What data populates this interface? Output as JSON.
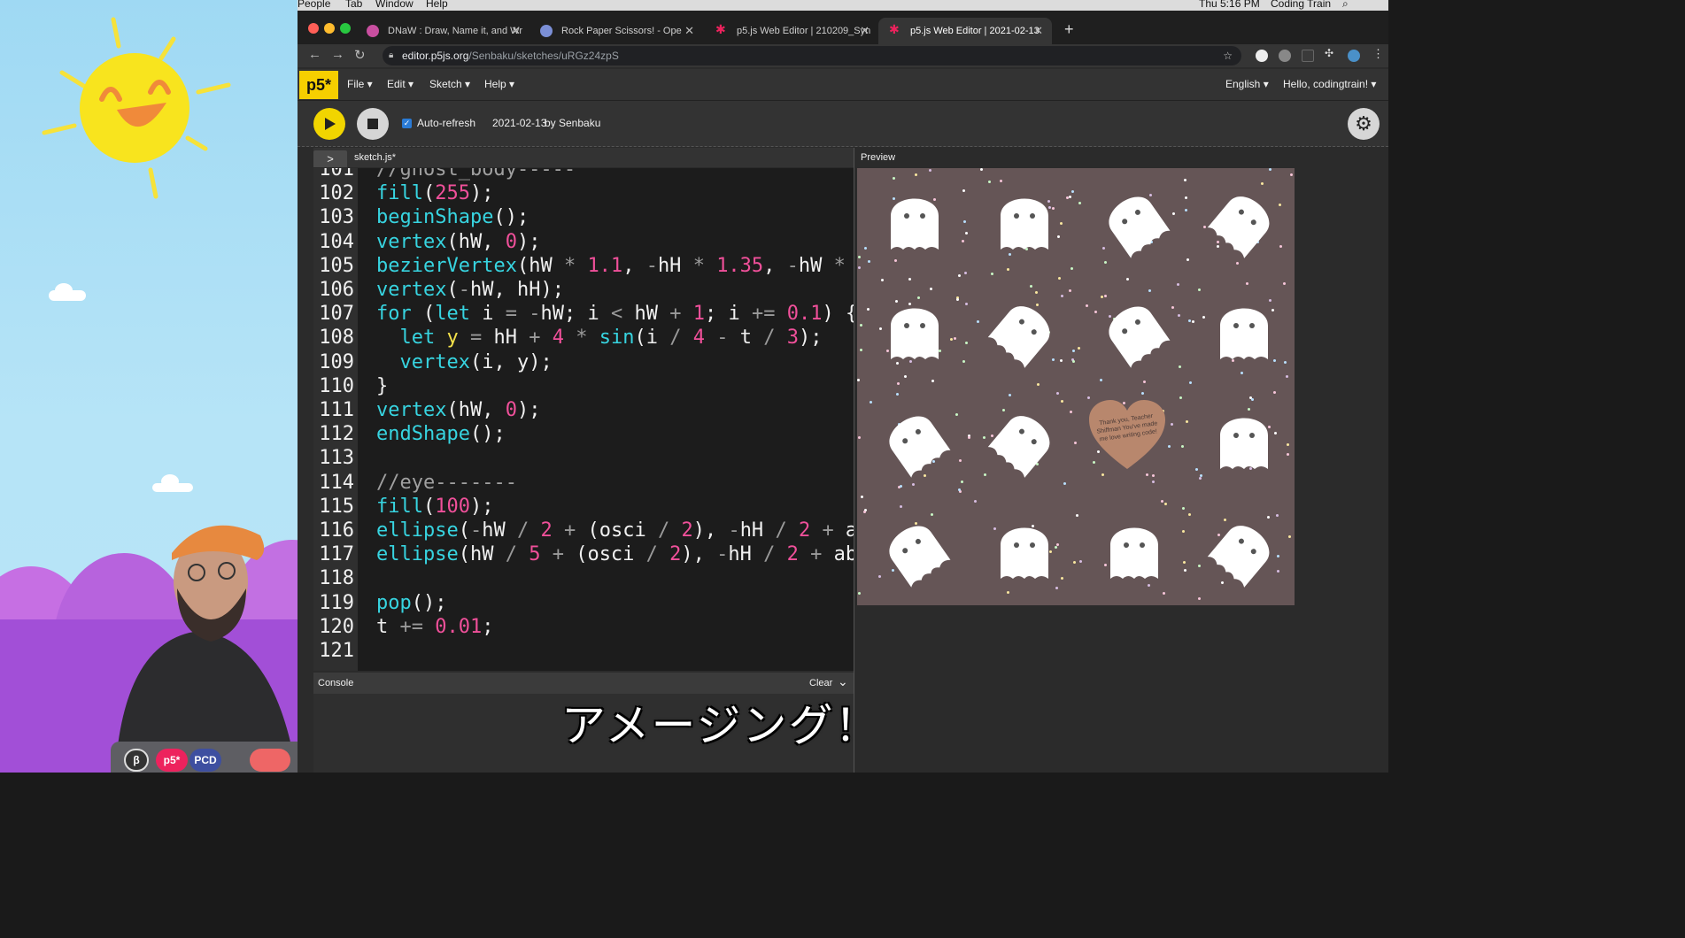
{
  "menubar": {
    "items": [
      "People",
      "Tab",
      "Window",
      "Help"
    ],
    "clock": "Thu 5:16 PM",
    "user": "Coding Train"
  },
  "browser": {
    "tabs": [
      {
        "label": "DNaW : Draw, Name it, and Wr",
        "favicon_color": "#c94fa0",
        "active": false
      },
      {
        "label": "Rock Paper Scissors! - Ope",
        "favicon_color": "#7b8fd6",
        "active": false
      },
      {
        "label": "p5.js Web Editor | 210209_Syn",
        "favicon_color": "#ed225d",
        "active": false
      },
      {
        "label": "p5.js Web Editor | 2021-02-13",
        "favicon_color": "#ed225d",
        "active": true
      }
    ],
    "new_tab": "+",
    "url_host": "editor.p5js.org",
    "url_path": "/Senbaku/sketches/uRGz24zpS"
  },
  "p5": {
    "logo": "p5*",
    "menu": [
      "File ▾",
      "Edit ▾",
      "Sketch ▾",
      "Help ▾"
    ],
    "language": "English ▾",
    "greeting": "Hello, codingtrain! ▾",
    "auto_refresh_label": "Auto-refresh",
    "auto_refresh_checked": true,
    "sketch_name": "2021-02-13",
    "author": "by Senbaku",
    "sidebar_toggle": ">",
    "file_name": "sketch.js*",
    "preview_label": "Preview",
    "console_label": "Console",
    "clear_label": "Clear",
    "console_chevron": "⌄"
  },
  "code": {
    "lines": [
      {
        "n": "101",
        "text": "//ghost_body-----"
      },
      {
        "n": "102",
        "text": "fill(255);"
      },
      {
        "n": "103",
        "text": "beginShape();"
      },
      {
        "n": "104",
        "text": "vertex(hW, 0);"
      },
      {
        "n": "105",
        "text": "bezierVertex(hW * 1.1, -hH * 1.35, -hW *"
      },
      {
        "n": "106",
        "text": "vertex(-hW, hH);"
      },
      {
        "n": "107",
        "text": "for (let i = -hW; i < hW + 1; i += 0.1) {"
      },
      {
        "n": "108",
        "text": "  let y = hH + 4 * sin(i / 4 - t / 3);"
      },
      {
        "n": "109",
        "text": "  vertex(i, y);"
      },
      {
        "n": "110",
        "text": "}"
      },
      {
        "n": "111",
        "text": "vertex(hW, 0);"
      },
      {
        "n": "112",
        "text": "endShape();"
      },
      {
        "n": "113",
        "text": ""
      },
      {
        "n": "114",
        "text": "//eye-------"
      },
      {
        "n": "115",
        "text": "fill(100);"
      },
      {
        "n": "116",
        "text": "ellipse(-hW / 2 + (osci / 2), -hH / 2 + a"
      },
      {
        "n": "117",
        "text": "ellipse(hW / 5 + (osci / 2), -hH / 2 + ab"
      },
      {
        "n": "118",
        "text": ""
      },
      {
        "n": "119",
        "text": "pop();"
      },
      {
        "n": "120",
        "text": "t += 0.01;"
      },
      {
        "n": "121",
        "text": ""
      }
    ]
  },
  "preview": {
    "heart_text": "Thank you, Teacher Shiffman You've made me love writing code!",
    "background": "#655556",
    "ghost_color": "#ffffff",
    "heart_color": "#b8876d"
  },
  "laptop_stickers": [
    "β",
    "p5*",
    "PCD"
  ],
  "subtitle": "アメージング！",
  "colors": {
    "accent_pink": "#ed225d",
    "play_yellow": "#f1d500",
    "code_cyan": "#37d4e0",
    "code_number": "#f0509a",
    "code_var": "#f3e14a"
  }
}
